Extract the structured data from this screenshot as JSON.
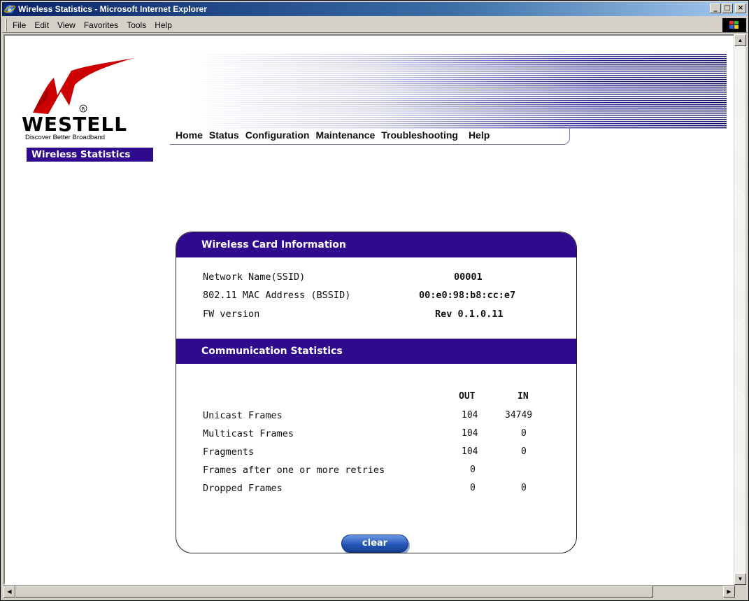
{
  "window": {
    "title": "Wireless Statistics - Microsoft Internet Explorer"
  },
  "menu": [
    "File",
    "Edit",
    "View",
    "Favorites",
    "Tools",
    "Help"
  ],
  "logo": {
    "brand": "WESTELL",
    "tagline": "Discover Better Broadband",
    "accent_color": "#cc0000"
  },
  "page_label": "Wireless Statistics",
  "nav": [
    "Home",
    "Status",
    "Configuration",
    "Maintenance",
    "Troubleshooting",
    "Help"
  ],
  "card": {
    "title": "Wireless Card Information",
    "rows": [
      {
        "label": "Network Name(SSID)",
        "value": "00001"
      },
      {
        "label": "802.11 MAC Address (BSSID)",
        "value": "00:e0:98:b8:cc:e7"
      },
      {
        "label": "FW version",
        "value": "Rev 0.1.0.11"
      }
    ]
  },
  "stats": {
    "title": "Communication Statistics",
    "col_out": "OUT",
    "col_in": "IN",
    "rows": [
      {
        "label": "Unicast Frames",
        "out": "104",
        "in": "34749"
      },
      {
        "label": "Multicast Frames",
        "out": "104",
        "in": "0"
      },
      {
        "label": "Fragments",
        "out": "104",
        "in": "0"
      },
      {
        "label": "Frames after one or more retries",
        "out": "0",
        "in": ""
      },
      {
        "label": "Dropped Frames",
        "out": "0",
        "in": "0"
      }
    ]
  },
  "clear_label": "clear",
  "colors": {
    "header_purple": "#2f0a8c",
    "title_blue": "#0a246a",
    "button_blue": "#2557b8"
  }
}
